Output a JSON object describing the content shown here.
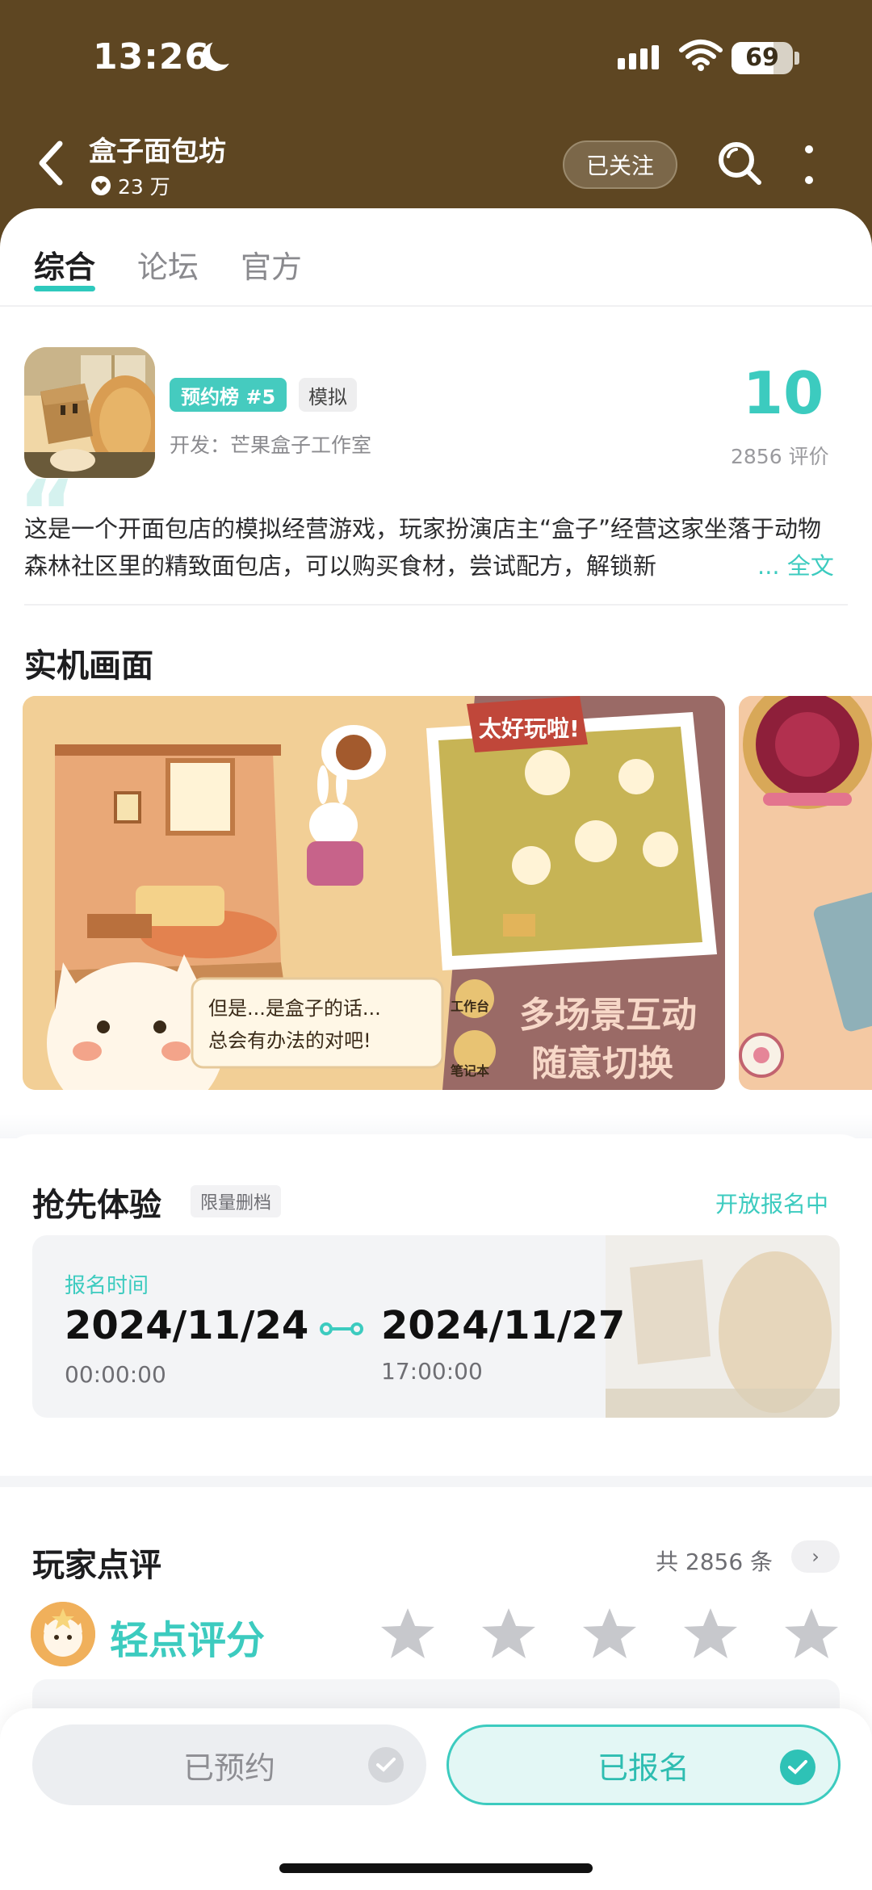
{
  "status_bar": {
    "time": "13:26",
    "battery": "69",
    "icons": [
      "moon-icon",
      "signal-icon",
      "wifi-icon",
      "battery-icon"
    ]
  },
  "nav": {
    "title": "盒子面包坊",
    "followers": "23 万",
    "follow_label": "已关注",
    "icons": [
      "back-icon",
      "heart-icon",
      "search-icon",
      "more-icon"
    ]
  },
  "tabs": [
    {
      "label": "综合",
      "active": true
    },
    {
      "label": "论坛",
      "active": false
    },
    {
      "label": "官方",
      "active": false
    }
  ],
  "game": {
    "rank_badge": "预约榜 #5",
    "genre": "模拟",
    "developer": "开发：芒果盒子工作室",
    "score": "10",
    "reviews": "2856 评价",
    "description": "这是一个开面包店的模拟经营游戏，玩家扮演店主“盒子”经营这家坐落于动物森林社区里的精致面包店，可以购买食材，尝试配方，解锁新",
    "more_label": "... 全文"
  },
  "screenshots": {
    "title": "实机画面",
    "shot1_texts": {
      "sign": "太好玩啦!",
      "dialog_line1": "但是...是盒子的话...",
      "dialog_line2": "总会有办法的对吧!",
      "workbench": "工作台",
      "notebook": "笔记本",
      "slogan_line1": "多场景互动",
      "slogan_line2": "随意切换"
    }
  },
  "early_access": {
    "title": "抢先体验",
    "tag": "限量删档",
    "status": "开放报名中",
    "label": "报名时间",
    "start_date": "2024/11/24",
    "start_time": "00:00:00",
    "end_date": "2024/11/27",
    "end_time": "17:00:00"
  },
  "player_reviews": {
    "title": "玩家点评",
    "count": "共 2856 条",
    "chevron": "›",
    "tap_rate": "轻点评分",
    "stars": 5
  },
  "bottom": {
    "reserved_label": "已预约",
    "registered_label": "已报名"
  },
  "colors": {
    "header_bg": "#5e4622",
    "accent": "#3ccbbf",
    "text": "#1d1d1f",
    "muted": "#8a8a8e"
  }
}
